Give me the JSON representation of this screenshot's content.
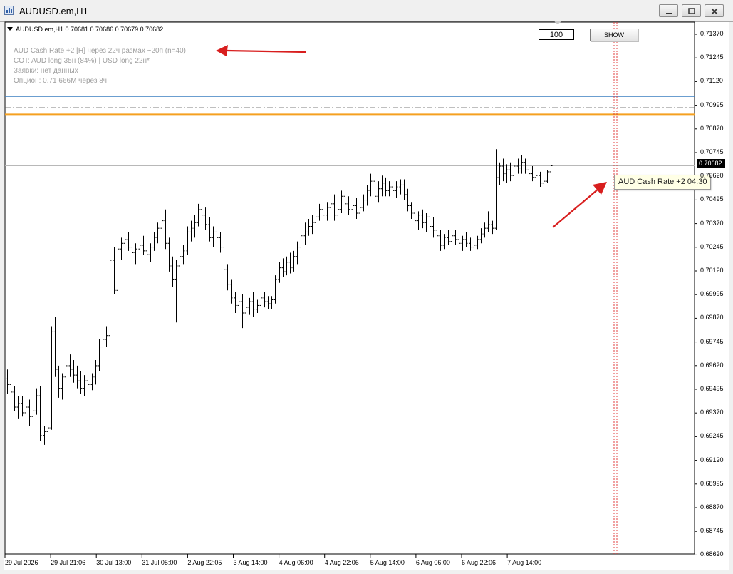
{
  "window": {
    "title": "AUDUSD.em,H1"
  },
  "chart_header": {
    "text": "AUDUSD.em,H1  0.70681 0.70686 0.70679 0.70682"
  },
  "info_panel": {
    "line1": "AUD Cash Rate +2 [H] через 22ч  размах ~20п (n=40)",
    "line2": "COT: AUD long 35н (84%)  |  USD long 22н*",
    "line3": "Заявки: нет данных",
    "line4": "Опцион: 0.71  666M  через 8ч"
  },
  "controls": {
    "count_value": "100",
    "show_label": "SHOW"
  },
  "current_price": "0.70682",
  "event_tooltip": "AUD Cash Rate +2  04:30",
  "y_axis": {
    "labels": [
      "0.71370",
      "0.71245",
      "0.71120",
      "0.70995",
      "0.70870",
      "0.70745",
      "0.70620",
      "0.70495",
      "0.70370",
      "0.70245",
      "0.70120",
      "0.69995",
      "0.69870",
      "0.69745",
      "0.69620",
      "0.69495",
      "0.69370",
      "0.69245",
      "0.69120",
      "0.68995",
      "0.68870",
      "0.68745",
      "0.68620"
    ]
  },
  "x_axis": {
    "labels": [
      "29 Jul 2026",
      "29 Jul 21:06",
      "30 Jul 13:00",
      "31 Jul 05:00",
      "2 Aug 22:05",
      "3 Aug 14:00",
      "4 Aug 06:00",
      "4 Aug 22:06",
      "5 Aug 14:00",
      "6 Aug 06:00",
      "6 Aug 22:06",
      "7 Aug 14:00"
    ]
  },
  "colors": {
    "annotation_arrow": "#d81e1e",
    "level_line_orange": "#f5a020",
    "level_line_blue": "#3a7ec0",
    "event_line": "#e04040"
  },
  "chart_data": {
    "type": "bar",
    "title": "AUDUSD.em,H1",
    "ylim": [
      0.6862,
      0.71445
    ],
    "levels": {
      "blue_line": 0.7105,
      "dashdot_line": 0.7099,
      "orange_line": 0.70955,
      "bid_line": 0.70682
    },
    "bars": [
      [
        0.6955,
        0.696,
        0.6947,
        0.6952
      ],
      [
        0.6952,
        0.6957,
        0.6945,
        0.6948
      ],
      [
        0.6948,
        0.6951,
        0.6938,
        0.694
      ],
      [
        0.694,
        0.6946,
        0.6934,
        0.6942
      ],
      [
        0.6942,
        0.6946,
        0.6935,
        0.6937
      ],
      [
        0.6937,
        0.6943,
        0.6933,
        0.694
      ],
      [
        0.694,
        0.6944,
        0.693,
        0.6935
      ],
      [
        0.6935,
        0.6942,
        0.6929,
        0.6938
      ],
      [
        0.6938,
        0.695,
        0.6936,
        0.6946
      ],
      [
        0.6946,
        0.6951,
        0.6922,
        0.6925
      ],
      [
        0.6925,
        0.693,
        0.692,
        0.6927
      ],
      [
        0.6927,
        0.6933,
        0.6922,
        0.6929
      ],
      [
        0.6929,
        0.6983,
        0.6928,
        0.698
      ],
      [
        0.698,
        0.6988,
        0.6956,
        0.696
      ],
      [
        0.696,
        0.6962,
        0.6945,
        0.695
      ],
      [
        0.695,
        0.6958,
        0.6944,
        0.6956
      ],
      [
        0.6956,
        0.6966,
        0.6952,
        0.6962
      ],
      [
        0.6962,
        0.6968,
        0.6956,
        0.696
      ],
      [
        0.696,
        0.6965,
        0.6953,
        0.6957
      ],
      [
        0.6957,
        0.6962,
        0.695,
        0.6954
      ],
      [
        0.6954,
        0.6959,
        0.6947,
        0.695
      ],
      [
        0.695,
        0.6957,
        0.6946,
        0.6954
      ],
      [
        0.6954,
        0.696,
        0.6948,
        0.6952
      ],
      [
        0.6952,
        0.6958,
        0.6949,
        0.6956
      ],
      [
        0.6956,
        0.6965,
        0.6952,
        0.6962
      ],
      [
        0.6962,
        0.6976,
        0.6959,
        0.6972
      ],
      [
        0.6972,
        0.698,
        0.6968,
        0.6976
      ],
      [
        0.6976,
        0.6983,
        0.6972,
        0.6978
      ],
      [
        0.6978,
        0.702,
        0.6976,
        0.7018
      ],
      [
        0.7018,
        0.7025,
        0.7,
        0.7002
      ],
      [
        0.7002,
        0.7028,
        0.7,
        0.7024
      ],
      [
        0.7024,
        0.703,
        0.7018,
        0.7027
      ],
      [
        0.7027,
        0.7032,
        0.7022,
        0.7029
      ],
      [
        0.7029,
        0.7033,
        0.7023,
        0.7025
      ],
      [
        0.7025,
        0.703,
        0.7019,
        0.7022
      ],
      [
        0.7022,
        0.7027,
        0.7016,
        0.7024
      ],
      [
        0.7024,
        0.7029,
        0.702,
        0.7026
      ],
      [
        0.7026,
        0.7031,
        0.7021,
        0.7023
      ],
      [
        0.7023,
        0.7029,
        0.7018,
        0.7021
      ],
      [
        0.7021,
        0.7027,
        0.7017,
        0.7025
      ],
      [
        0.7025,
        0.7033,
        0.7023,
        0.703
      ],
      [
        0.703,
        0.7038,
        0.7027,
        0.7035
      ],
      [
        0.7035,
        0.7043,
        0.7032,
        0.7039
      ],
      [
        0.7039,
        0.7045,
        0.7024,
        0.7027
      ],
      [
        0.7027,
        0.703,
        0.7012,
        0.7015
      ],
      [
        0.7015,
        0.702,
        0.7004,
        0.7008
      ],
      [
        0.7008,
        0.7018,
        0.6985,
        0.7015
      ],
      [
        0.7015,
        0.7024,
        0.7012,
        0.702
      ],
      [
        0.702,
        0.7026,
        0.7016,
        0.7023
      ],
      [
        0.7023,
        0.7036,
        0.7021,
        0.7033
      ],
      [
        0.7033,
        0.7039,
        0.7028,
        0.7035
      ],
      [
        0.7035,
        0.7042,
        0.703,
        0.7038
      ],
      [
        0.7038,
        0.7048,
        0.7036,
        0.7045
      ],
      [
        0.7045,
        0.7052,
        0.704,
        0.7042
      ],
      [
        0.7042,
        0.7046,
        0.7034,
        0.7037
      ],
      [
        0.7037,
        0.7041,
        0.7028,
        0.703
      ],
      [
        0.703,
        0.7036,
        0.7025,
        0.7033
      ],
      [
        0.7033,
        0.7039,
        0.7028,
        0.703
      ],
      [
        0.703,
        0.7033,
        0.7022,
        0.7025
      ],
      [
        0.7025,
        0.7028,
        0.701,
        0.7013
      ],
      [
        0.7013,
        0.7016,
        0.7002,
        0.7005
      ],
      [
        0.7005,
        0.7008,
        0.6995,
        0.6998
      ],
      [
        0.6998,
        0.7001,
        0.699,
        0.6994
      ],
      [
        0.6994,
        0.6999,
        0.6986,
        0.6996
      ],
      [
        0.6996,
        0.7,
        0.6982,
        0.699
      ],
      [
        0.699,
        0.6995,
        0.6987,
        0.6993
      ],
      [
        0.6993,
        0.6998,
        0.6989,
        0.6996
      ],
      [
        0.6996,
        0.7001,
        0.6988,
        0.6992
      ],
      [
        0.6992,
        0.6997,
        0.699,
        0.6994
      ],
      [
        0.6994,
        0.7,
        0.6992,
        0.6998
      ],
      [
        0.6998,
        0.7001,
        0.6993,
        0.6996
      ],
      [
        0.6996,
        0.6999,
        0.6992,
        0.6995
      ],
      [
        0.6995,
        0.6999,
        0.6992,
        0.6997
      ],
      [
        0.6997,
        0.701,
        0.6995,
        0.7008
      ],
      [
        0.7008,
        0.7017,
        0.7006,
        0.7014
      ],
      [
        0.7014,
        0.7019,
        0.7009,
        0.7012
      ],
      [
        0.7012,
        0.702,
        0.701,
        0.7017
      ],
      [
        0.7017,
        0.7022,
        0.7011,
        0.7014
      ],
      [
        0.7014,
        0.7023,
        0.7012,
        0.702
      ],
      [
        0.702,
        0.7028,
        0.7016,
        0.7025
      ],
      [
        0.7025,
        0.7034,
        0.7023,
        0.7031
      ],
      [
        0.7031,
        0.7038,
        0.7026,
        0.7033
      ],
      [
        0.7033,
        0.704,
        0.7031,
        0.7036
      ],
      [
        0.7036,
        0.7042,
        0.7032,
        0.7038
      ],
      [
        0.7038,
        0.7044,
        0.7036,
        0.7041
      ],
      [
        0.7041,
        0.7048,
        0.7039,
        0.7045
      ],
      [
        0.7045,
        0.705,
        0.704,
        0.7042
      ],
      [
        0.7042,
        0.7049,
        0.7039,
        0.7046
      ],
      [
        0.7046,
        0.7052,
        0.7043,
        0.7048
      ],
      [
        0.7048,
        0.7053,
        0.7039,
        0.7042
      ],
      [
        0.7042,
        0.7048,
        0.7038,
        0.7045
      ],
      [
        0.7045,
        0.7055,
        0.7043,
        0.7052
      ],
      [
        0.7052,
        0.7057,
        0.7046,
        0.7048
      ],
      [
        0.7048,
        0.7052,
        0.7042,
        0.7045
      ],
      [
        0.7045,
        0.7051,
        0.704,
        0.7047
      ],
      [
        0.7047,
        0.7051,
        0.704,
        0.7043
      ],
      [
        0.7043,
        0.7049,
        0.7039,
        0.7046
      ],
      [
        0.7046,
        0.7053,
        0.7044,
        0.705
      ],
      [
        0.705,
        0.7058,
        0.7047,
        0.7055
      ],
      [
        0.7055,
        0.7064,
        0.7052,
        0.706
      ],
      [
        0.706,
        0.7065,
        0.7049,
        0.7052
      ],
      [
        0.7052,
        0.706,
        0.7049,
        0.7056
      ],
      [
        0.7056,
        0.7063,
        0.7052,
        0.7059
      ],
      [
        0.7059,
        0.7062,
        0.7052,
        0.7055
      ],
      [
        0.7055,
        0.706,
        0.7052,
        0.7057
      ],
      [
        0.7057,
        0.7061,
        0.7052,
        0.7055
      ],
      [
        0.7055,
        0.706,
        0.7051,
        0.7057
      ],
      [
        0.7057,
        0.7061,
        0.7053,
        0.7058
      ],
      [
        0.7058,
        0.7061,
        0.705,
        0.7053
      ],
      [
        0.7053,
        0.7056,
        0.7044,
        0.7047
      ],
      [
        0.7047,
        0.7049,
        0.704,
        0.7043
      ],
      [
        0.7043,
        0.7046,
        0.7036,
        0.7039
      ],
      [
        0.7039,
        0.7044,
        0.7034,
        0.7042
      ],
      [
        0.7042,
        0.7045,
        0.7035,
        0.7038
      ],
      [
        0.7038,
        0.7043,
        0.7033,
        0.7041
      ],
      [
        0.7041,
        0.7044,
        0.7033,
        0.7036
      ],
      [
        0.7036,
        0.7041,
        0.703,
        0.7034
      ],
      [
        0.7034,
        0.7038,
        0.7029,
        0.7031
      ],
      [
        0.7031,
        0.7034,
        0.7023,
        0.7026
      ],
      [
        0.7026,
        0.7032,
        0.7024,
        0.703
      ],
      [
        0.703,
        0.7034,
        0.7026,
        0.7028
      ],
      [
        0.7028,
        0.7033,
        0.7025,
        0.7031
      ],
      [
        0.7031,
        0.7034,
        0.7026,
        0.7029
      ],
      [
        0.7029,
        0.7032,
        0.7024,
        0.7027
      ],
      [
        0.7027,
        0.7031,
        0.7023,
        0.7029
      ],
      [
        0.7029,
        0.7033,
        0.7025,
        0.7027
      ],
      [
        0.7027,
        0.703,
        0.7023,
        0.7025
      ],
      [
        0.7025,
        0.7029,
        0.7023,
        0.7026
      ],
      [
        0.7026,
        0.7031,
        0.7024,
        0.7029
      ],
      [
        0.7029,
        0.7035,
        0.7027,
        0.7032
      ],
      [
        0.7032,
        0.7038,
        0.703,
        0.7035
      ],
      [
        0.7035,
        0.7044,
        0.7033,
        0.7037
      ],
      [
        0.7037,
        0.7039,
        0.7032,
        0.7035
      ],
      [
        0.7035,
        0.7077,
        0.7034,
        0.7062
      ],
      [
        0.7062,
        0.707,
        0.7058,
        0.7068
      ],
      [
        0.7068,
        0.7072,
        0.706,
        0.7064
      ],
      [
        0.7064,
        0.7069,
        0.7059,
        0.7066
      ],
      [
        0.7066,
        0.707,
        0.706,
        0.7063
      ],
      [
        0.7063,
        0.707,
        0.7061,
        0.7068
      ],
      [
        0.7068,
        0.7072,
        0.7064,
        0.7067
      ],
      [
        0.7067,
        0.7074,
        0.7064,
        0.707
      ],
      [
        0.707,
        0.7072,
        0.7064,
        0.7066
      ],
      [
        0.7066,
        0.707,
        0.7061,
        0.7064
      ],
      [
        0.7064,
        0.7068,
        0.706,
        0.7062
      ],
      [
        0.7062,
        0.7066,
        0.7059,
        0.7063
      ],
      [
        0.7063,
        0.7065,
        0.7057,
        0.7059
      ],
      [
        0.7059,
        0.7062,
        0.7057,
        0.706
      ],
      [
        0.706,
        0.7066,
        0.7059,
        0.7065
      ],
      [
        0.7065,
        0.7069,
        0.7064,
        0.70682
      ]
    ]
  }
}
